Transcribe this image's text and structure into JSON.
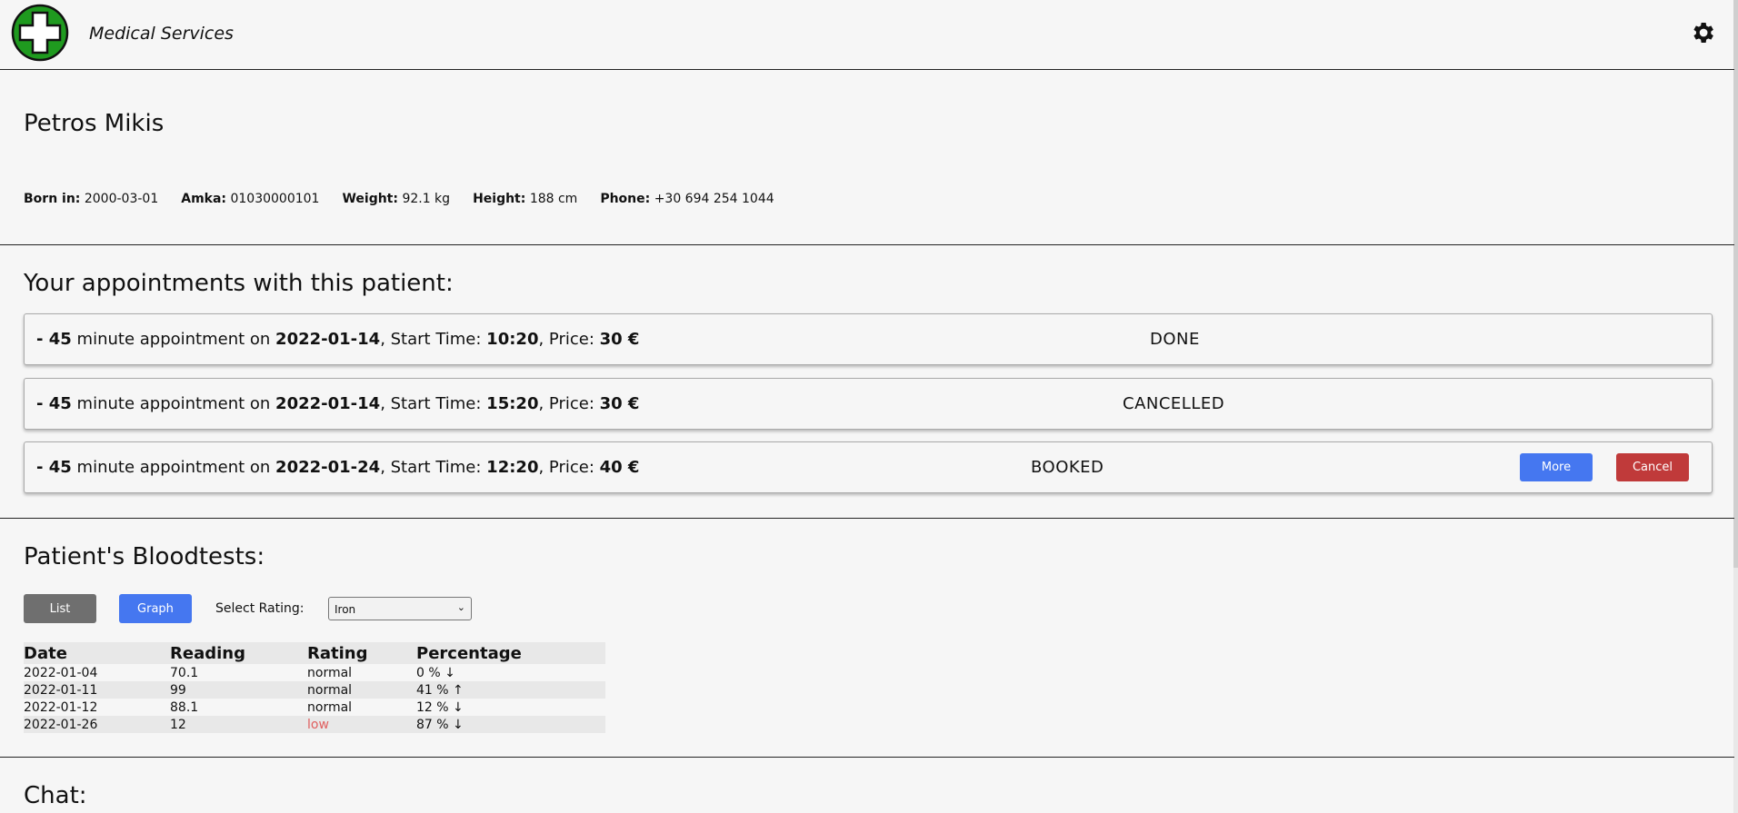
{
  "app": {
    "title": "Medical Services",
    "accent": "#4577f0",
    "danger": "#c03a3a",
    "logo_icon": "green-cross-logo",
    "settings_icon": "gear-icon"
  },
  "patient": {
    "name": "Petros Mikis",
    "born_label": "Born in:",
    "born": "2000-03-01",
    "amka_label": "Amka:",
    "amka": "01030000101",
    "weight_label": "Weight:",
    "weight": "92.1 kg",
    "height_label": "Height:",
    "height": "188 cm",
    "phone_label": "Phone:",
    "phone": "+30 694 254 1044"
  },
  "appointments": {
    "title": "Your appointments with this patient:",
    "prefix": "- ",
    "minute_text": " minute appointment on ",
    "start_text": ", Start Time: ",
    "price_text": ", Price: ",
    "items": [
      {
        "duration": "45",
        "date": "2022-01-14",
        "time": "10:20",
        "price": "30 €",
        "status": "DONE"
      },
      {
        "duration": "45",
        "date": "2022-01-14",
        "time": "15:20",
        "price": "30 €",
        "status": "CANCELLED"
      },
      {
        "duration": "45",
        "date": "2022-01-24",
        "time": "12:20",
        "price": "40 €",
        "status": "BOOKED",
        "more_label": "More",
        "cancel_label": "Cancel"
      }
    ]
  },
  "bloodtests": {
    "title": "Patient's Bloodtests:",
    "list_label": "List",
    "graph_label": "Graph",
    "select_label": "Select Rating:",
    "select_value": "Iron",
    "columns": [
      "Date",
      "Reading",
      "Rating",
      "Percentage"
    ],
    "rows": [
      {
        "date": "2022-01-04",
        "reading": "70.1",
        "rating": "normal",
        "percentage": "0 %",
        "arrow": "↓"
      },
      {
        "date": "2022-01-11",
        "reading": "99",
        "rating": "normal",
        "percentage": "41 %",
        "arrow": "↑"
      },
      {
        "date": "2022-01-12",
        "reading": "88.1",
        "rating": "normal",
        "percentage": "12 %",
        "arrow": "↓"
      },
      {
        "date": "2022-01-26",
        "reading": "12",
        "rating": "low",
        "percentage": "87 %",
        "arrow": "↓"
      }
    ]
  },
  "chat": {
    "title": "Chat:"
  }
}
